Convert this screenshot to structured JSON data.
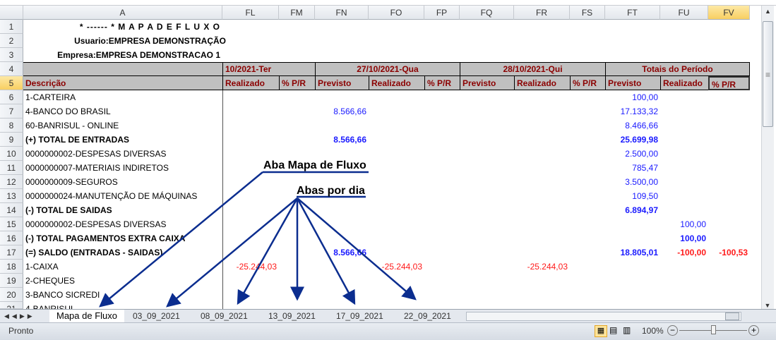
{
  "columns": [
    "A",
    "FL",
    "FM",
    "FN",
    "FO",
    "FP",
    "FQ",
    "FR",
    "FS",
    "FT",
    "FU",
    "FV"
  ],
  "selected_column": "FV",
  "rows": [
    "1",
    "2",
    "3",
    "4",
    "5",
    "6",
    "7",
    "8",
    "9",
    "10",
    "11",
    "12",
    "13",
    "14",
    "15",
    "16",
    "17",
    "18",
    "19",
    "20",
    "21"
  ],
  "header": {
    "title": "* ------ * M A P A   D E   F L U X O",
    "usuario": "Usuario:EMPRESA DEMONSTRAÇÃO",
    "empresa": "Empresa:EMPRESA DEMONSTRACAO 1",
    "date1": "10/2021-Ter",
    "date2": "27/10/2021-Qua",
    "date3": "28/10/2021-Qui",
    "totals": "Totais do Período",
    "descricao": "Descrição",
    "previsto": "Previsto",
    "realizado": "Realizado",
    "pr": "% P/R"
  },
  "data_rows": [
    {
      "desc": "1-CARTEIRA",
      "bold": false,
      "FT": "100,00"
    },
    {
      "desc": "4-BANCO DO BRASIL",
      "bold": false,
      "FN": "8.566,66",
      "FT": "17.133,32"
    },
    {
      "desc": "60-BANRISUL - ONLINE",
      "bold": false,
      "FT": "8.466,66"
    },
    {
      "desc": "(+) TOTAL DE ENTRADAS",
      "bold": true,
      "FN": "8.566,66",
      "FT": "25.699,98"
    },
    {
      "desc": "0000000002-DESPESAS DIVERSAS",
      "bold": false,
      "FT": "2.500,00"
    },
    {
      "desc": "0000000007-MATERIAIS INDIRETOS",
      "bold": false,
      "FT": "785,47"
    },
    {
      "desc": "0000000009-SEGUROS",
      "bold": false,
      "FT": "3.500,00"
    },
    {
      "desc": "0000000024-MANUTENÇÃO DE MÁQUINAS",
      "bold": false,
      "FT": "109,50"
    },
    {
      "desc": "(-) TOTAL DE SAIDAS",
      "bold": true,
      "FT": "6.894,97"
    },
    {
      "desc": "0000000002-DESPESAS DIVERSAS",
      "bold": false,
      "FU": "100,00"
    },
    {
      "desc": "(-) TOTAL PAGAMENTOS EXTRA CAIXA",
      "bold": true,
      "FU": "100,00"
    },
    {
      "desc": "(=) SALDO (ENTRADAS - SAIDAS)",
      "bold": true,
      "FN": "8.566,66",
      "FT": "18.805,01",
      "FU": "-100,00",
      "FV": "-100,53"
    },
    {
      "desc": "1-CAIXA",
      "bold": false,
      "FL": "-25.244,03",
      "FO": "-25.244,03",
      "FR": "-25.244,03"
    },
    {
      "desc": "2-CHEQUES",
      "bold": false
    },
    {
      "desc": "3-BANCO SICREDI",
      "bold": false
    },
    {
      "desc": "4-BANRISUL",
      "bold": false
    }
  ],
  "annotations": {
    "main_tab": "Aba Mapa de Fluxo",
    "day_tabs": "Abas por dia"
  },
  "sheet_tabs": [
    "Mapa de Fluxo",
    "03_09_2021",
    "08_09_2021",
    "13_09_2021",
    "17_09_2021",
    "22_09_2021"
  ],
  "active_tab": "Mapa de Fluxo",
  "status": {
    "ready": "Pronto",
    "zoom": "100%"
  },
  "colors": {
    "header_text": "#8b0000",
    "value_blue": "#1a1aff",
    "negative_red": "#ff1a1a",
    "annotation_line": "#0b2d8f"
  }
}
